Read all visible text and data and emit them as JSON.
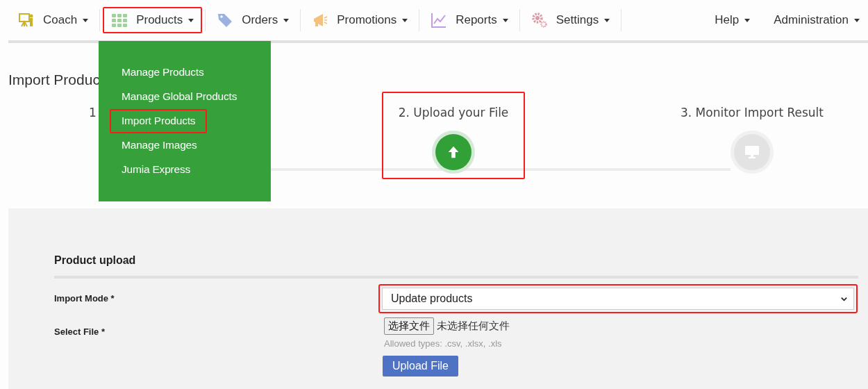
{
  "nav": {
    "menus": [
      {
        "label": "Coach",
        "highlighted": false
      },
      {
        "label": "Products",
        "highlighted": true
      },
      {
        "label": "Orders",
        "highlighted": false
      },
      {
        "label": "Promotions",
        "highlighted": false
      },
      {
        "label": "Reports",
        "highlighted": false
      },
      {
        "label": "Settings",
        "highlighted": false
      }
    ],
    "right_menus": [
      {
        "label": "Help"
      },
      {
        "label": "Administration"
      }
    ],
    "dropdown": [
      {
        "label": "Manage Products",
        "highlighted": false
      },
      {
        "label": "Manage Global Products",
        "highlighted": false
      },
      {
        "label": "Import Products",
        "highlighted": true
      },
      {
        "label": "Manage Images",
        "highlighted": false
      },
      {
        "label": "Jumia Express",
        "highlighted": false
      }
    ]
  },
  "page_title": "Import Produc",
  "steps": [
    {
      "label": "1"
    },
    {
      "label": "2. Upload your File",
      "active": true,
      "highlighted": true
    },
    {
      "label": "3. Monitor Import Result",
      "active": false,
      "highlighted": false
    }
  ],
  "form": {
    "title": "Product upload",
    "import_mode": {
      "label": "Import Mode *",
      "value": "Update products",
      "highlighted": true
    },
    "select_file": {
      "label": "Select File *",
      "button": "选择文件",
      "status": "未选择任何文件",
      "hint": "Allowed types: .csv, .xlsx, .xls"
    },
    "submit": "Upload File"
  }
}
